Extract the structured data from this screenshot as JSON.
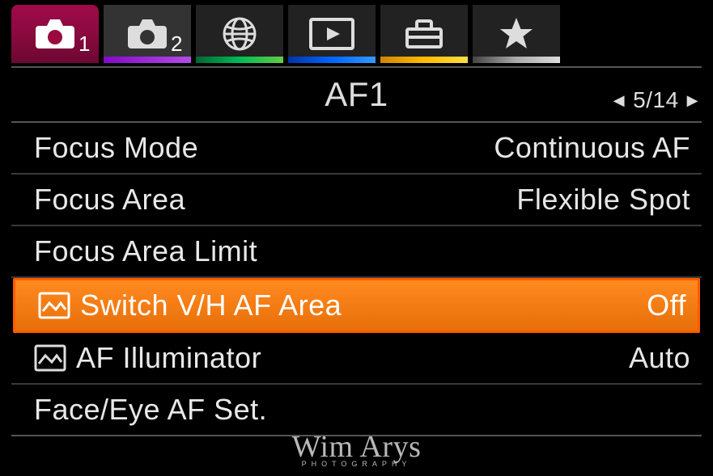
{
  "tabs": {
    "cam1_badge": "1",
    "cam2_badge": "2"
  },
  "page": {
    "title": "AF1",
    "index": "5",
    "total": "14",
    "sep": "/"
  },
  "rows": [
    {
      "label": "Focus Mode",
      "value": "Continuous AF",
      "icon": false
    },
    {
      "label": "Focus Area",
      "value": "Flexible Spot",
      "icon": false
    },
    {
      "label": "Focus Area Limit",
      "value": "",
      "icon": false
    },
    {
      "label": "Switch V/H AF Area",
      "value": "Off",
      "icon": true
    },
    {
      "label": "AF Illuminator",
      "value": "Auto",
      "icon": true
    },
    {
      "label": "Face/Eye AF Set.",
      "value": "",
      "icon": false
    }
  ],
  "watermark": {
    "signature": "Wim Arys",
    "sub": "PHOTOGRAPHY"
  }
}
